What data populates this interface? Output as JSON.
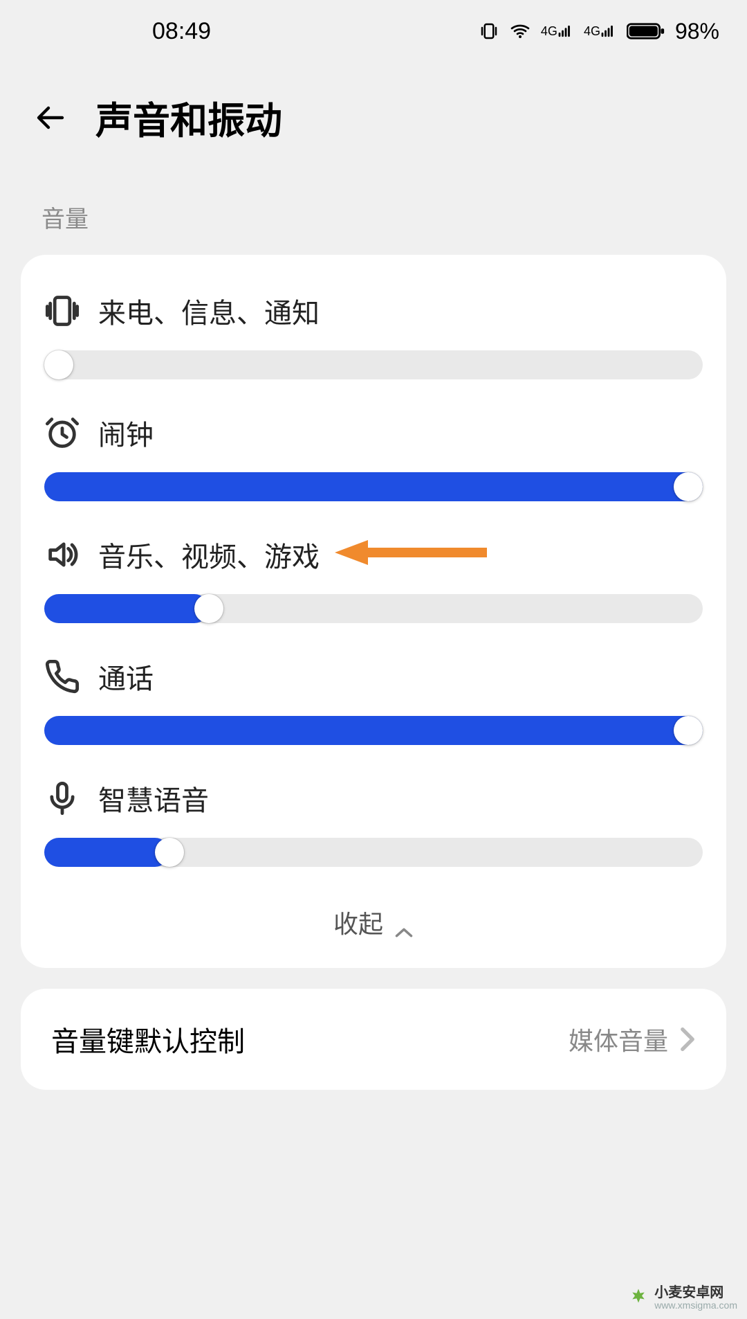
{
  "status_bar": {
    "time": "08:49",
    "battery_percent": "98%"
  },
  "header": {
    "title": "声音和振动"
  },
  "volume_section": {
    "label": "音量",
    "sliders": [
      {
        "id": "ringtone",
        "icon": "vibrate-icon",
        "label": "来电、信息、通知",
        "value": 0
      },
      {
        "id": "alarm",
        "icon": "alarm-icon",
        "label": "闹钟",
        "value": 100
      },
      {
        "id": "media",
        "icon": "speaker-icon",
        "label": "音乐、视频、游戏",
        "value": 25,
        "annotated": true
      },
      {
        "id": "call",
        "icon": "phone-icon",
        "label": "通话",
        "value": 100
      },
      {
        "id": "voice",
        "icon": "mic-icon",
        "label": "智慧语音",
        "value": 19
      }
    ],
    "collapse_label": "收起"
  },
  "volume_key": {
    "label": "音量键默认控制",
    "value": "媒体音量"
  },
  "watermark": {
    "title": "小麦安卓网",
    "url": "www.xmsigma.com"
  },
  "colors": {
    "accent": "#1f4fe3",
    "annotation": "#f08a2d"
  }
}
